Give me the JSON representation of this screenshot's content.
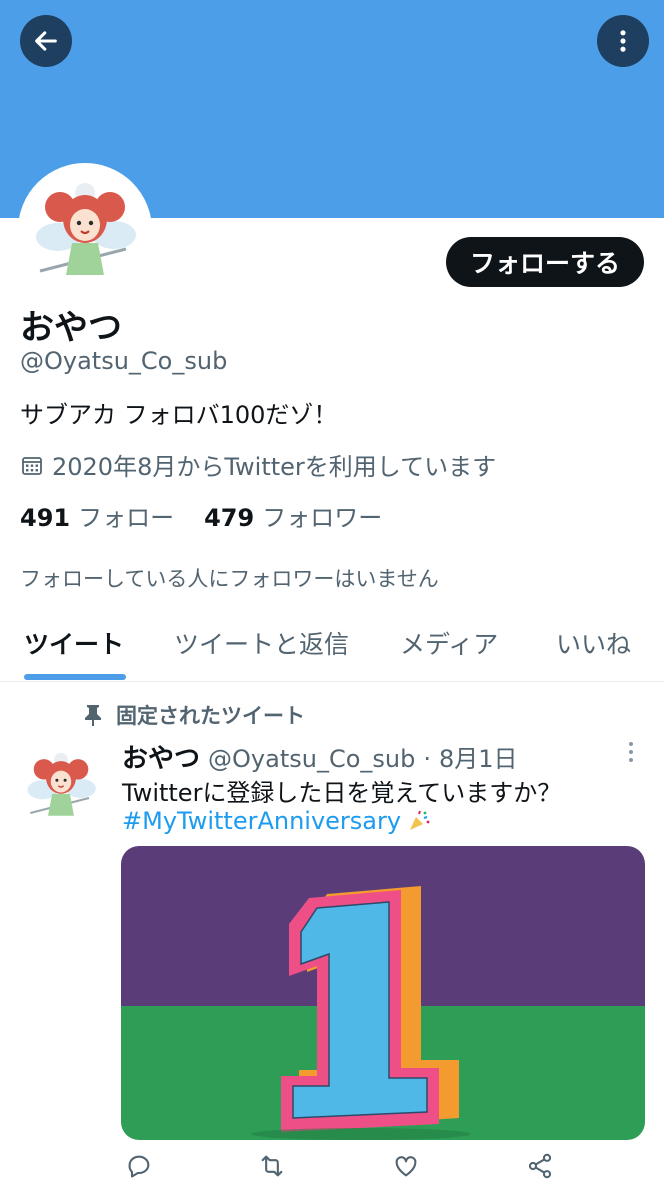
{
  "header": {
    "back_icon": "arrow-left-icon",
    "more_icon": "more-vertical-icon"
  },
  "profile": {
    "follow_label": "フォローする",
    "name": "おやつ",
    "handle": "@Oyatsu_Co_sub",
    "bio": "サブアカ フォロバ100だゾ！",
    "joined": "2020年8月からTwitterを利用しています",
    "following_count": "491",
    "following_label": "フォロー",
    "followers_count": "479",
    "followers_label": "フォロワー",
    "followers_note": "フォローしている人にフォロワーはいません"
  },
  "tabs": [
    {
      "label": "ツイート"
    },
    {
      "label": "ツイートと返信"
    },
    {
      "label": "メディア"
    },
    {
      "label": "いいね"
    }
  ],
  "tweet": {
    "pinned_label": "固定されたツイート",
    "name": "おやつ",
    "handle": "@Oyatsu_Co_sub",
    "separator": "·",
    "date": "8月1日",
    "text": "Twitterに登録した日を覚えていますか？",
    "hashtag": "#MyTwitterAnniversary",
    "image_label": "1"
  },
  "colors": {
    "banner": "#4d9ee8",
    "accent": "#1d9bf0",
    "media_bg_top": "#5a3d78",
    "media_bg_bottom": "#2e9e56",
    "numeral_fill": "#4fb8e6",
    "numeral_outline": "#ee4f86",
    "numeral_side": "#f39b2e"
  }
}
